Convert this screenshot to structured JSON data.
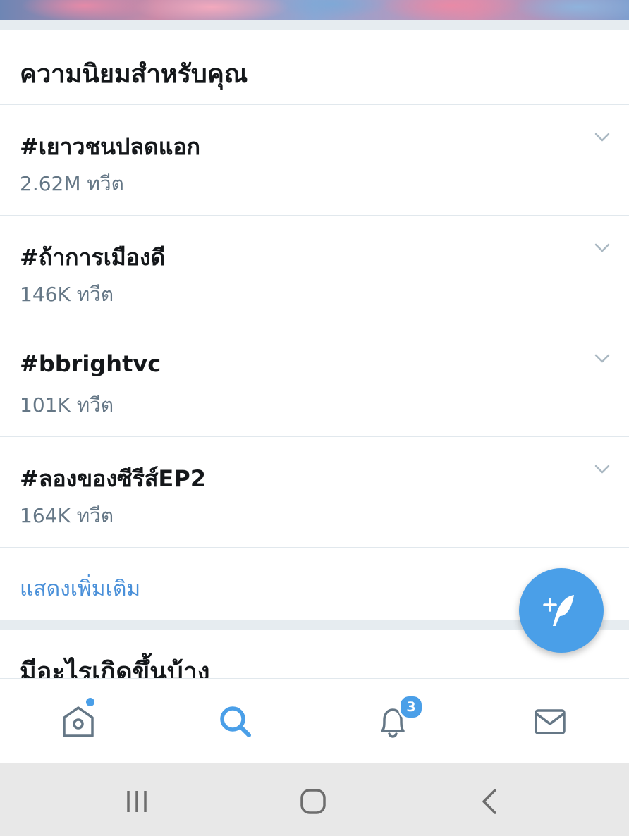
{
  "trends_section": {
    "title": "ความนิยมสำหรับคุณ",
    "items": [
      {
        "name": "#เยาวชนปลดแอก",
        "count": "2.62M ทวีต"
      },
      {
        "name": "#ถ้าการเมืองดี",
        "count": "146K ทวีต"
      },
      {
        "name": "#bbrightvc",
        "count": "101K ทวีต"
      },
      {
        "name": "#ลองของซีรีส์EP2",
        "count": "164K ทวีต"
      }
    ],
    "show_more": "แสดงเพิ่มเติม"
  },
  "whats_happening": {
    "title": "มีอะไรเกิดขึ้นบ้าง"
  },
  "fab": {
    "icon": "compose-tweet-icon",
    "color": "#4a9fe8"
  },
  "bottom_nav": {
    "items": [
      {
        "icon": "home-icon",
        "active": false,
        "has_dot": true
      },
      {
        "icon": "search-icon",
        "active": true
      },
      {
        "icon": "notifications-bell-icon",
        "badge": "3"
      },
      {
        "icon": "messages-envelope-icon"
      }
    ]
  },
  "system_nav": {
    "items": [
      {
        "icon": "recent-apps-icon"
      },
      {
        "icon": "home-button-icon"
      },
      {
        "icon": "back-icon"
      }
    ]
  },
  "colors": {
    "accent": "#4a9fe8",
    "secondary_text": "#657786",
    "divider": "#e1e8ed"
  }
}
